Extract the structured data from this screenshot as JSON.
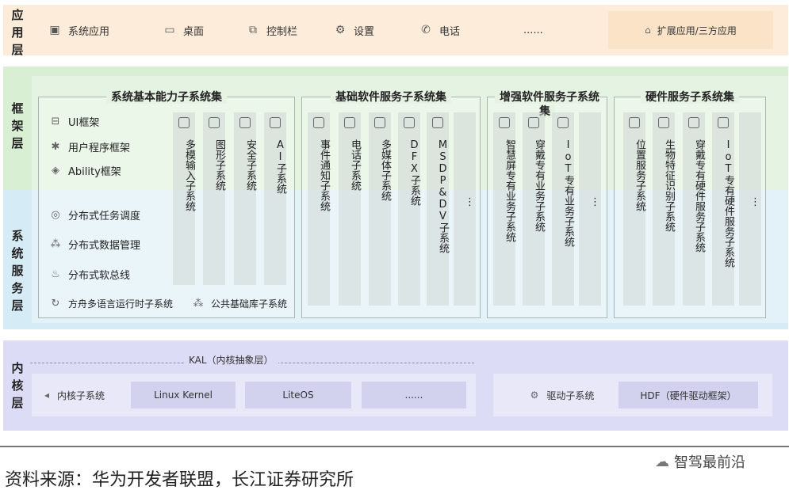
{
  "layers": {
    "app": "应用层",
    "framework": "框架层",
    "system_service": "系统服务层",
    "kernel": "内核层"
  },
  "app_items": [
    {
      "label": "系统应用",
      "icon": "app-window-icon"
    },
    {
      "label": "桌面",
      "icon": "monitor-icon"
    },
    {
      "label": "控制栏",
      "icon": "control-bar-icon"
    },
    {
      "label": "设置",
      "icon": "gear-icon"
    },
    {
      "label": "电话",
      "icon": "phone-icon"
    },
    {
      "label": "......",
      "icon": ""
    }
  ],
  "app_ext": {
    "label": "扩展应用/三方应用",
    "icon": "house-icon"
  },
  "groups": {
    "basic": {
      "title": "系统基本能力子系统集",
      "framework_items": [
        {
          "label": "UI框架",
          "icon": "ui-frame-icon"
        },
        {
          "label": "用户程序框架",
          "icon": "app-framework-icon"
        },
        {
          "label": "Ability框架",
          "icon": "ability-icon"
        }
      ],
      "service_items": [
        {
          "label": "分布式任务调度",
          "icon": "task-schedule-icon"
        },
        {
          "label": "分布式数据管理",
          "icon": "data-management-icon"
        },
        {
          "label": "分布式软总线",
          "icon": "soft-bus-icon"
        }
      ],
      "columns": [
        "多模输入子系统",
        "图形子系统",
        "安全子系统",
        "AI子系统"
      ],
      "bottom_left": "方舟多语言运行时子系统",
      "bottom_right": "公共基础库子系统"
    },
    "basic_software": {
      "title": "基础软件服务子系统集",
      "columns": [
        "事件通知子系统",
        "电话子系统",
        "多媒体子系统",
        "DFX子系统",
        "MSDP&DV子系统",
        "⋮"
      ]
    },
    "enhanced_software": {
      "title": "增强软件服务子系统集",
      "columns": [
        "智慧屏专有业务子系统",
        "穿戴专有业务子系统",
        "IoT专有业务子系统",
        "⋮"
      ]
    },
    "hardware": {
      "title": "硬件服务子系统集",
      "columns": [
        "位置服务子系统",
        "生物特征识别子系统",
        "穿戴专有硬件服务子系统",
        "IoT专有硬件服务子系统",
        "⋮"
      ]
    }
  },
  "kernel": {
    "kal": "KAL（内核抽象层）",
    "kernel_subsystem": "内核子系统",
    "cells": [
      "Linux Kernel",
      "LiteOS",
      "......"
    ],
    "driver_subsystem": "驱动子系统",
    "hdf": "HDF（硬件驱动框架）"
  },
  "source": "资料来源：华为开发者联盟，长江证券研究所",
  "brand": "智驾最前沿",
  "colors": {
    "app_layer": "#fdecd9",
    "framework_layer": "#d8efd3",
    "system_layer": "#d5ebf6",
    "kernel_layer": "#dcdcf6"
  }
}
